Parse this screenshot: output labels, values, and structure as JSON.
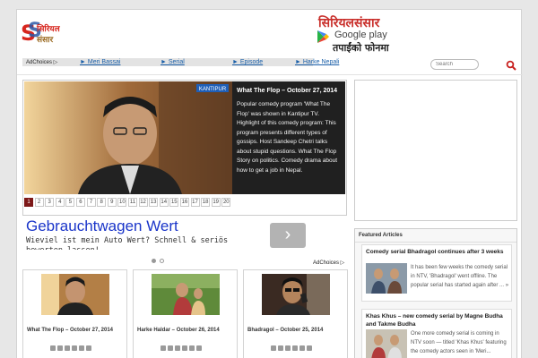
{
  "header": {
    "logo_text_line1": "सिरियल",
    "logo_text_line2": "संसार",
    "banner_title": "सिरियलसंसार",
    "banner_store": "Google play",
    "banner_tagline": "तपाईंको फोनमा"
  },
  "nav": {
    "adchoices": "AdChoices ▷",
    "links": [
      "► Meri Bassai",
      "► Serial",
      "► Episode",
      "► Harke Nepali"
    ],
    "search_placeholder": "Search"
  },
  "slider": {
    "title": "What The Flop – October 27, 2014",
    "body": "Popular comedy program 'What The Flop' was shown in Kantipur TV. Highlight of this comedy program: This program presents different types of gossips. Host Sandeep Chetri talks about stupid questions. What The Flop Story on politics. Comedy drama about how to get a job in Nepal.",
    "pages": [
      "1",
      "2",
      "3",
      "4",
      "5",
      "6",
      "7",
      "8",
      "9",
      "10",
      "11",
      "12",
      "13",
      "14",
      "15",
      "16",
      "17",
      "18",
      "19",
      "20"
    ],
    "active_page": "1",
    "watermark": "KANTIPUR"
  },
  "ad": {
    "headline": "Gebrauchtwagen Wert",
    "subline": "Wieviel ist mein Auto Wert? Schnell & seriös",
    "subline2": "bewerten lassen!",
    "adchoices": "AdChoices ▷"
  },
  "cards": [
    {
      "title": "What The Flop – October 27, 2014"
    },
    {
      "title": "Harke Haldar – October 26, 2014"
    },
    {
      "title": "Bhadragol – October 25, 2014"
    }
  ],
  "featured": {
    "heading": "Featured Articles",
    "items": [
      {
        "title": "Comedy serial Bhadragol continues after 3 weeks",
        "body": "It has been few weeks the comedy serial in NTV, 'Bhadragol' went offline. The popular serial has started again after ... »"
      },
      {
        "title": "Khas Khus – new comedy serial by Magne Budha and Takme Budha",
        "body": "One more comedy serial is coming in NTV soon — titled 'Khas Khus' featuring the comedy actors seen in 'Meri..."
      }
    ]
  }
}
